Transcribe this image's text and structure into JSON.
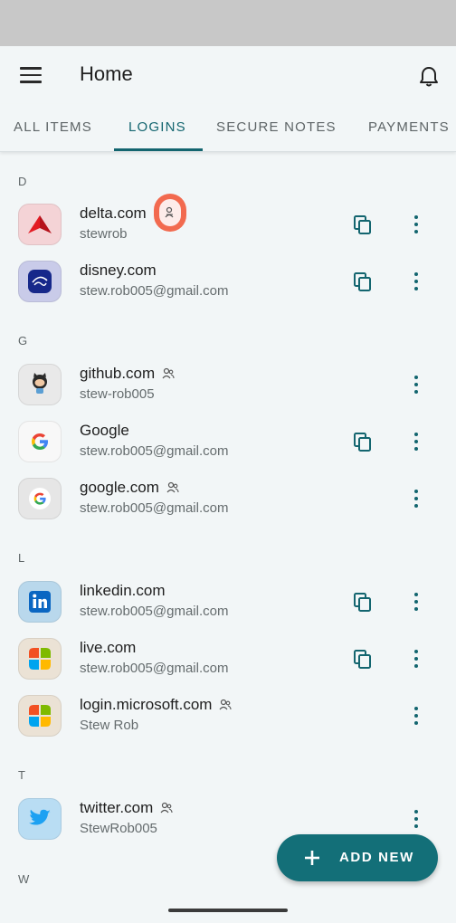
{
  "header": {
    "title": "Home"
  },
  "tabs": [
    {
      "label": "ALL ITEMS"
    },
    {
      "label": "LOGINS"
    },
    {
      "label": "SECURE NOTES"
    },
    {
      "label": "PAYMENTS"
    }
  ],
  "active_tab": "LOGINS",
  "sections": [
    {
      "letter": "D"
    },
    {
      "letter": "G"
    },
    {
      "letter": "L"
    },
    {
      "letter": "T"
    },
    {
      "letter": "W"
    }
  ],
  "items": [
    {
      "name": "delta.com",
      "subtitle": "stewrob",
      "icon": "delta-logo-icon",
      "shared": true,
      "copy": true
    },
    {
      "name": "disney.com",
      "subtitle": "stew.rob005@gmail.com",
      "icon": "disney-logo-icon",
      "shared": false,
      "copy": true
    },
    {
      "name": "github.com",
      "subtitle": "stew-rob005",
      "icon": "github-logo-icon",
      "shared": true,
      "copy": false
    },
    {
      "name": "Google",
      "subtitle": "stew.rob005@gmail.com",
      "icon": "google-logo-icon",
      "shared": false,
      "copy": true
    },
    {
      "name": "google.com",
      "subtitle": "stew.rob005@gmail.com",
      "icon": "google-logo-icon",
      "shared": true,
      "copy": false
    },
    {
      "name": "linkedin.com",
      "subtitle": "stew.rob005@gmail.com",
      "icon": "linkedin-logo-icon",
      "shared": false,
      "copy": true
    },
    {
      "name": "live.com",
      "subtitle": "stew.rob005@gmail.com",
      "icon": "microsoft-logo-icon",
      "shared": false,
      "copy": true
    },
    {
      "name": "login.microsoft.com",
      "subtitle": "Stew Rob",
      "icon": "microsoft-logo-icon",
      "shared": true,
      "copy": false
    },
    {
      "name": "twitter.com",
      "subtitle": "StewRob005",
      "icon": "twitter-logo-icon",
      "shared": true,
      "copy": false
    }
  ],
  "fab": {
    "label": "ADD NEW"
  },
  "colors": {
    "accent": "#13656f",
    "fab": "#136f78",
    "highlight": "#f26a4f",
    "status_bar": "#c8c8c8",
    "background": "#f2f6f7"
  }
}
